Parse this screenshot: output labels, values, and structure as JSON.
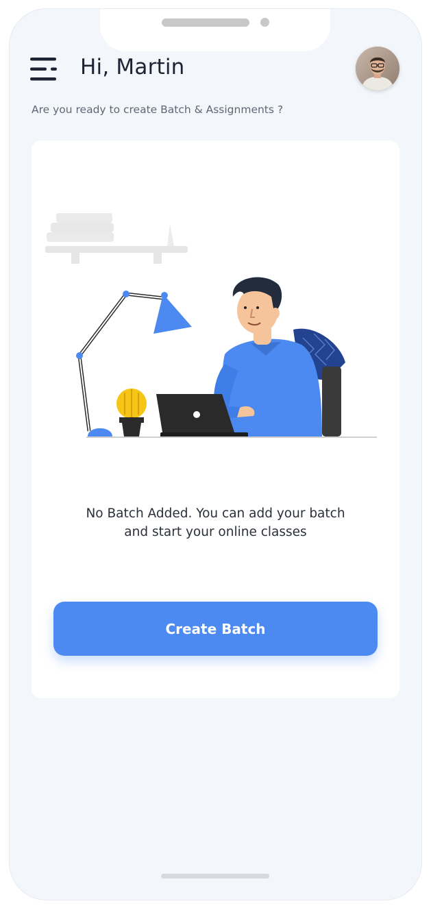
{
  "header": {
    "greeting": "Hi, Martin",
    "subtitle": "Are you ready to create Batch & Assignments ?"
  },
  "icons": {
    "menu": "menu-icon",
    "avatar": "user-avatar"
  },
  "empty_state": {
    "line1": "No Batch Added. You can add your batch",
    "line2": "and start your online classes"
  },
  "actions": {
    "create_batch_label": "Create Batch"
  },
  "colors": {
    "accent": "#4c8af1",
    "background": "#f3f7fb",
    "card": "#ffffff",
    "text_primary": "#1c2333"
  }
}
